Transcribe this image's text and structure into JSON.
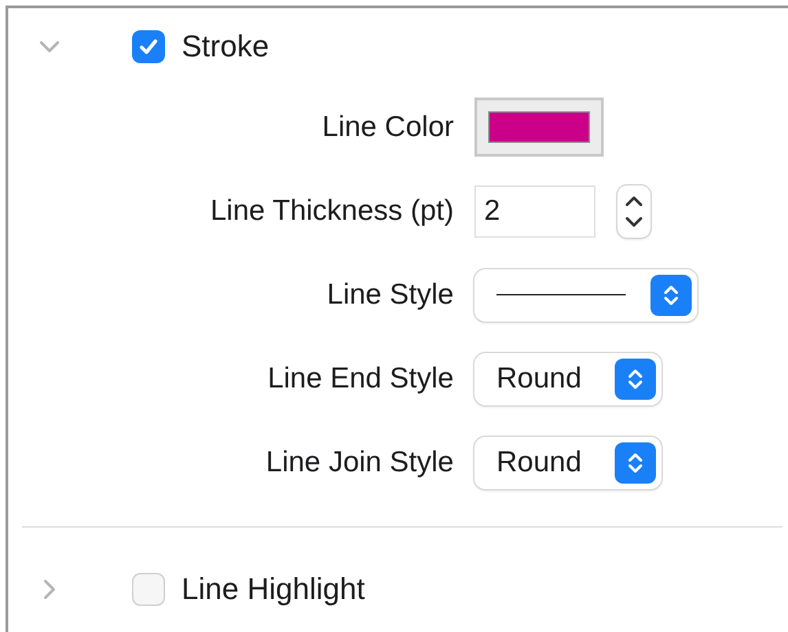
{
  "sections": [
    {
      "label": "Stroke",
      "expanded": true,
      "checked": true,
      "fields": [
        {
          "kind": "color",
          "label": "Line Color",
          "color": "#cc0088"
        },
        {
          "kind": "number",
          "label": "Line Thickness (pt)",
          "value": "2"
        },
        {
          "kind": "line",
          "label": "Line Style"
        },
        {
          "kind": "popup",
          "label": "Line End Style",
          "value": "Round"
        },
        {
          "kind": "popup",
          "label": "Line Join Style",
          "value": "Round"
        }
      ]
    },
    {
      "label": "Line Highlight",
      "expanded": false,
      "checked": false
    }
  ]
}
